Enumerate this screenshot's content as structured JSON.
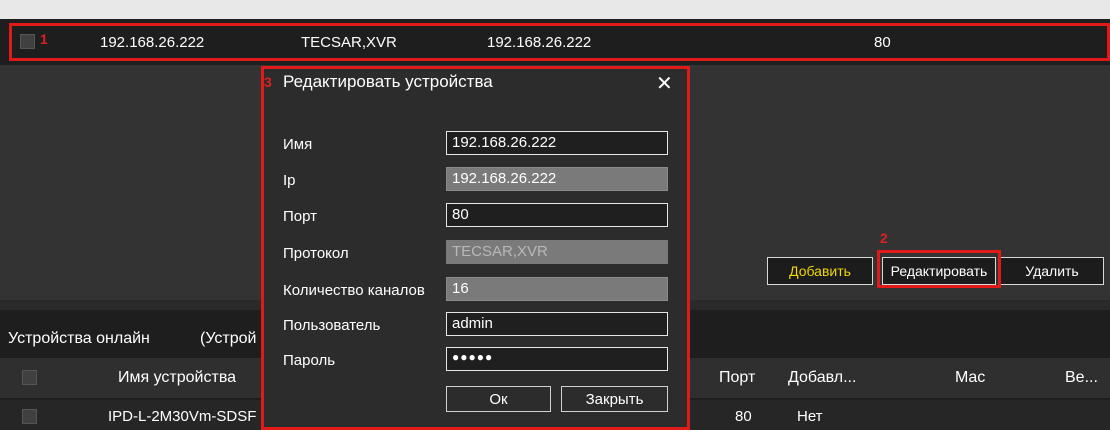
{
  "device_row": {
    "marker": "1",
    "name": "192.168.26.222",
    "protocol": "TECSAR,XVR",
    "ip": "192.168.26.222",
    "port": "80"
  },
  "buttons": {
    "add": "Добавить",
    "edit": "Редактировать",
    "edit_marker": "2",
    "delete": "Удалить"
  },
  "tabs": {
    "online": "Устройства онлайн",
    "second_partial": "(Устрой"
  },
  "table": {
    "columns": [
      "Имя устройства",
      "Порт",
      "Добавл...",
      "Mac",
      "Ве..."
    ],
    "rows": [
      {
        "name": "IPD-L-2M30Vm-SDSF",
        "port": "80",
        "added": "Нет"
      }
    ]
  },
  "dialog": {
    "marker": "3",
    "title": "Редактировать устройства",
    "close_glyph": "✕",
    "fields": {
      "name_label": "Имя",
      "name_value": "192.168.26.222",
      "ip_label": "Ip",
      "ip_value": "192.168.26.222",
      "port_label": "Порт",
      "port_value": "80",
      "protocol_label": "Протокол",
      "protocol_value": "TECSAR,XVR",
      "channels_label": "Количество каналов",
      "channels_value": "16",
      "user_label": "Пользователь",
      "user_value": "admin",
      "password_label": "Пароль",
      "password_value": "●●●●●"
    },
    "ok": "Ок",
    "close": "Закрыть"
  },
  "colors": {
    "highlight": "#e01919",
    "add_button_text": "#f2d700"
  }
}
